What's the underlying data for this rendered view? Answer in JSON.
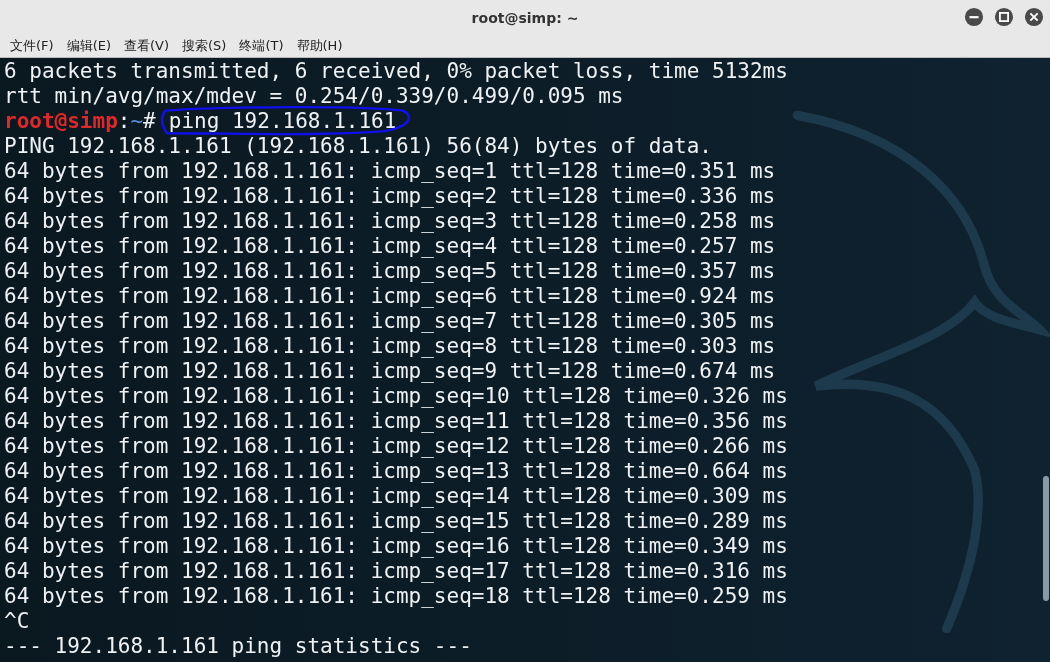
{
  "window": {
    "title": "root@simp: ~"
  },
  "menu": [
    {
      "label": "文件(F)"
    },
    {
      "label": "编辑(E)"
    },
    {
      "label": "查看(V)"
    },
    {
      "label": "搜索(S)"
    },
    {
      "label": "终端(T)"
    },
    {
      "label": "帮助(H)"
    }
  ],
  "terminal": {
    "lines": [
      {
        "kind": "output",
        "text": "6 packets transmitted, 6 received, 0% packet loss, time 5132ms"
      },
      {
        "kind": "output",
        "text": "rtt min/avg/max/mdev = 0.254/0.339/0.499/0.095 ms"
      },
      {
        "kind": "prompt",
        "user": "root@simp",
        "separator": ":",
        "path": "~",
        "symbol": "#",
        "command": "ping 192.168.1.161",
        "circled": true
      },
      {
        "kind": "output",
        "text": "PING 192.168.1.161 (192.168.1.161) 56(84) bytes of data."
      },
      {
        "kind": "output",
        "text": "64 bytes from 192.168.1.161: icmp_seq=1 ttl=128 time=0.351 ms"
      },
      {
        "kind": "output",
        "text": "64 bytes from 192.168.1.161: icmp_seq=2 ttl=128 time=0.336 ms"
      },
      {
        "kind": "output",
        "text": "64 bytes from 192.168.1.161: icmp_seq=3 ttl=128 time=0.258 ms"
      },
      {
        "kind": "output",
        "text": "64 bytes from 192.168.1.161: icmp_seq=4 ttl=128 time=0.257 ms"
      },
      {
        "kind": "output",
        "text": "64 bytes from 192.168.1.161: icmp_seq=5 ttl=128 time=0.357 ms"
      },
      {
        "kind": "output",
        "text": "64 bytes from 192.168.1.161: icmp_seq=6 ttl=128 time=0.924 ms"
      },
      {
        "kind": "output",
        "text": "64 bytes from 192.168.1.161: icmp_seq=7 ttl=128 time=0.305 ms"
      },
      {
        "kind": "output",
        "text": "64 bytes from 192.168.1.161: icmp_seq=8 ttl=128 time=0.303 ms"
      },
      {
        "kind": "output",
        "text": "64 bytes from 192.168.1.161: icmp_seq=9 ttl=128 time=0.674 ms"
      },
      {
        "kind": "output",
        "text": "64 bytes from 192.168.1.161: icmp_seq=10 ttl=128 time=0.326 ms"
      },
      {
        "kind": "output",
        "text": "64 bytes from 192.168.1.161: icmp_seq=11 ttl=128 time=0.356 ms"
      },
      {
        "kind": "output",
        "text": "64 bytes from 192.168.1.161: icmp_seq=12 ttl=128 time=0.266 ms"
      },
      {
        "kind": "output",
        "text": "64 bytes from 192.168.1.161: icmp_seq=13 ttl=128 time=0.664 ms"
      },
      {
        "kind": "output",
        "text": "64 bytes from 192.168.1.161: icmp_seq=14 ttl=128 time=0.309 ms"
      },
      {
        "kind": "output",
        "text": "64 bytes from 192.168.1.161: icmp_seq=15 ttl=128 time=0.289 ms"
      },
      {
        "kind": "output",
        "text": "64 bytes from 192.168.1.161: icmp_seq=16 ttl=128 time=0.349 ms"
      },
      {
        "kind": "output",
        "text": "64 bytes from 192.168.1.161: icmp_seq=17 ttl=128 time=0.316 ms"
      },
      {
        "kind": "output",
        "text": "64 bytes from 192.168.1.161: icmp_seq=18 ttl=128 time=0.259 ms"
      },
      {
        "kind": "output",
        "text": "^C"
      },
      {
        "kind": "output",
        "text": "--- 192.168.1.161 ping statistics ---"
      }
    ]
  }
}
